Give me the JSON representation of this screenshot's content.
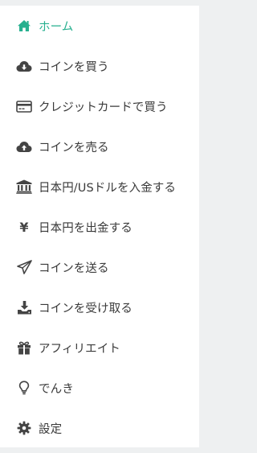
{
  "menu": {
    "items": [
      {
        "label": "ホーム",
        "icon": "home-icon",
        "active": true
      },
      {
        "label": "コインを買う",
        "icon": "cloud-download-icon"
      },
      {
        "label": "クレジットカードで買う",
        "icon": "credit-card-icon"
      },
      {
        "label": "コインを売る",
        "icon": "cloud-upload-icon"
      },
      {
        "label": "日本円/USドルを入金する",
        "icon": "bank-icon"
      },
      {
        "label": "日本円を出金する",
        "icon": "yen-icon"
      },
      {
        "label": "コインを送る",
        "icon": "paper-plane-icon"
      },
      {
        "label": "コインを受け取る",
        "icon": "download-tray-icon"
      },
      {
        "label": "アフィリエイト",
        "icon": "gift-icon"
      },
      {
        "label": "でんき",
        "icon": "lightbulb-icon"
      },
      {
        "label": "設定",
        "icon": "gear-icon"
      }
    ]
  },
  "icons": {
    "yen_glyph": "¥"
  },
  "colors": {
    "accent": "#27b08f",
    "text": "#3a3a3a",
    "icon": "#444444",
    "panel_background": "#ffffff",
    "page_background": "#eef0f1"
  }
}
